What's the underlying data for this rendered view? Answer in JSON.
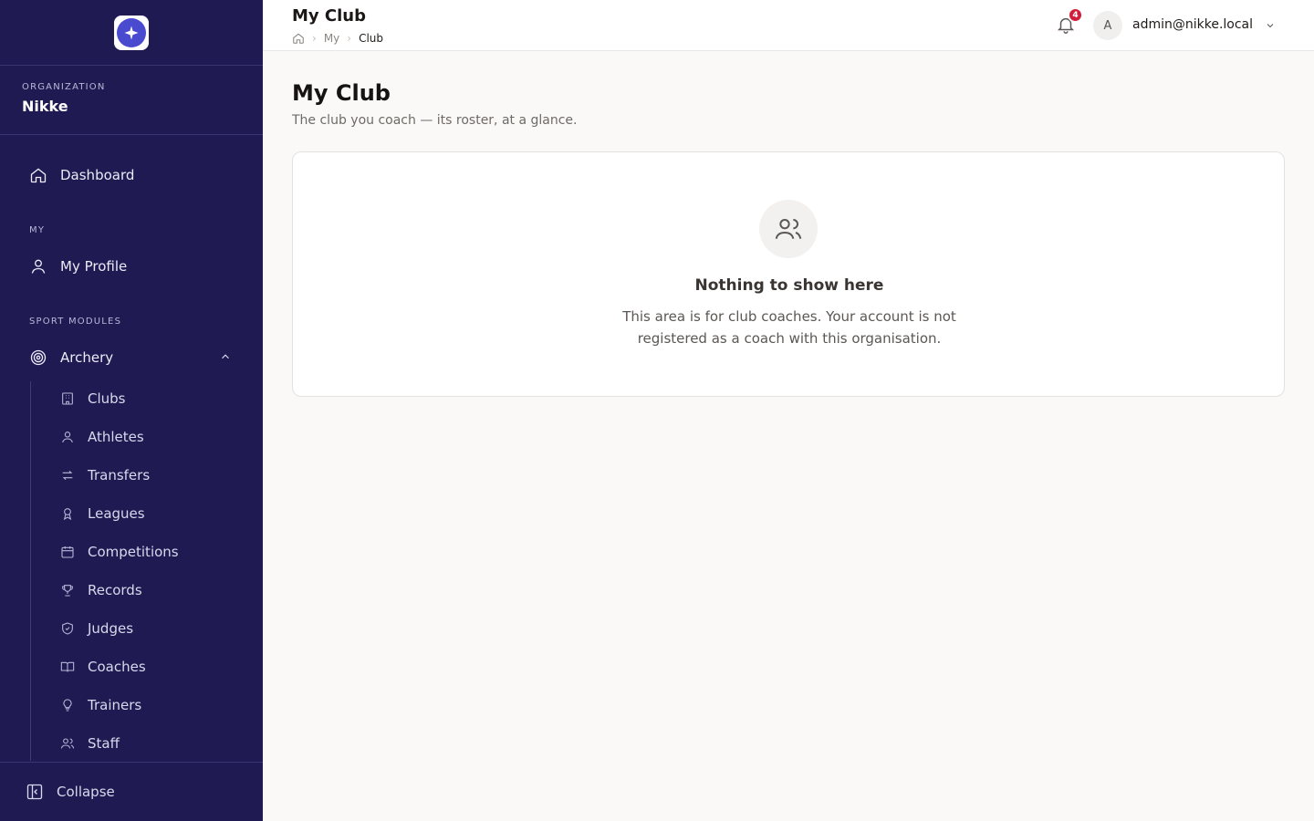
{
  "sidebar": {
    "org_label": "ORGANIZATION",
    "org_name": "Nikke",
    "dashboard": "Dashboard",
    "section_my": "MY",
    "my_profile": "My Profile",
    "section_sport": "SPORT MODULES",
    "archery": "Archery",
    "sub_items": [
      "Clubs",
      "Athletes",
      "Transfers",
      "Leagues",
      "Competitions",
      "Records",
      "Judges",
      "Coaches",
      "Trainers",
      "Staff"
    ],
    "collapse": "Collapse"
  },
  "topbar": {
    "title": "My Club",
    "breadcrumb": [
      "My",
      "Club"
    ],
    "notification_count": "4",
    "avatar_initial": "A",
    "user_email": "admin@nikke.local"
  },
  "main": {
    "title": "My Club",
    "subtitle": "The club you coach — its roster, at a glance.",
    "empty_title": "Nothing to show here",
    "empty_text": "This area is for club coaches. Your account is not registered as a coach with this organisation."
  },
  "colors": {
    "sidebar_bg": "#1f1a52",
    "badge": "#d11d3a"
  }
}
